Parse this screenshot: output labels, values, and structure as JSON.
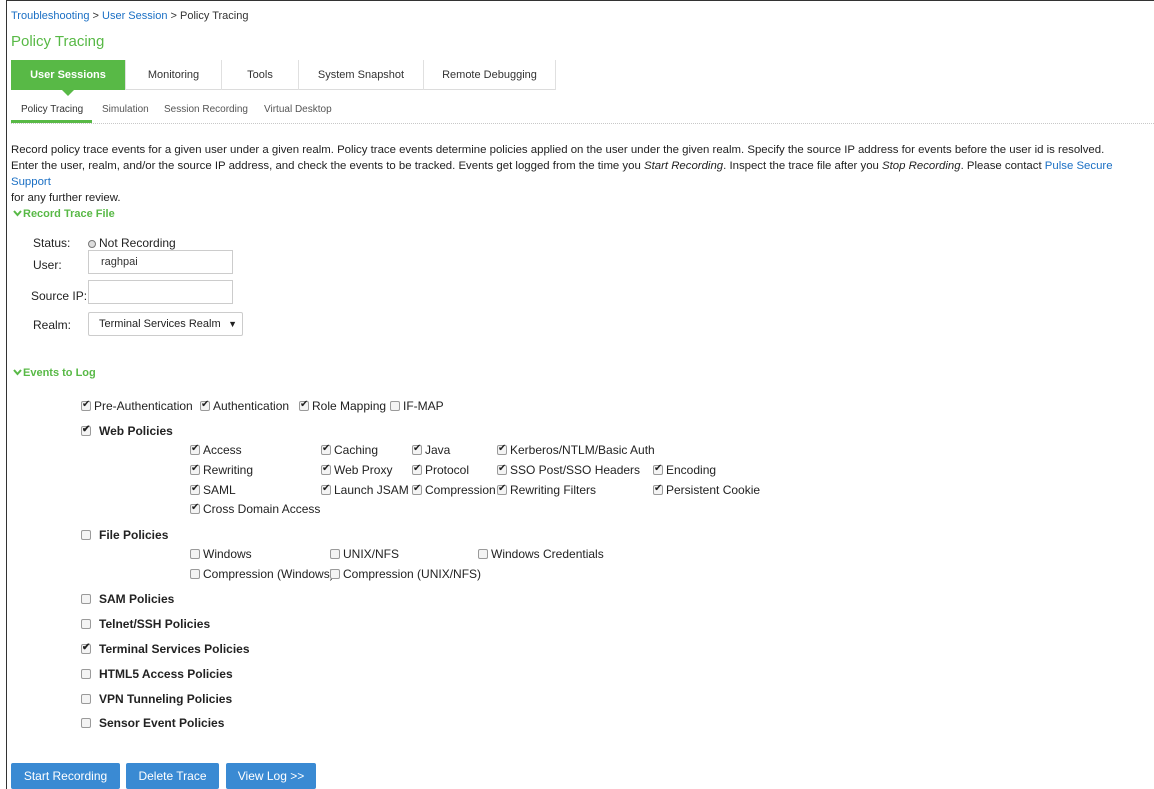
{
  "breadcrumb": {
    "part1": "Troubleshooting",
    "sep1": " > ",
    "part2": "User Session",
    "sep2": " > ",
    "current": "Policy Tracing"
  },
  "page_title": "Policy Tracing",
  "tabs": [
    {
      "label": "User Sessions",
      "active": true
    },
    {
      "label": "Monitoring"
    },
    {
      "label": "Tools"
    },
    {
      "label": "System Snapshot"
    },
    {
      "label": "Remote Debugging"
    }
  ],
  "subtabs": [
    "Policy Tracing",
    "Simulation",
    "Session Recording",
    "Virtual Desktop"
  ],
  "description": {
    "line1": "Record policy trace events for a given user under a given realm. Policy trace events determine policies applied on the user under the given realm. Specify the source IP address for events before the user id is resolved.",
    "line2a": "Enter the user, realm, and/or the source IP address, and check the events to be tracked. Events get logged from the time you ",
    "line2b": "Start Recording",
    "line2c": ". Inspect the trace file after you ",
    "line2d": "Stop Recording",
    "line2e": ". Please contact ",
    "link": "Pulse Secure Support",
    "line3": "for any further review."
  },
  "record_trace": {
    "header": "Record Trace File",
    "status_label": "Status:",
    "status_value": "Not Recording",
    "user_label": "User:",
    "user_value": "raghpai",
    "source_ip_label": "Source IP:",
    "source_ip_value": "",
    "realm_label": "Realm:",
    "realm_value": "Terminal Services Realm"
  },
  "events": {
    "header": "Events to Log",
    "top": [
      {
        "label": "Pre-Authentication",
        "checked": true
      },
      {
        "label": "Authentication",
        "checked": true
      },
      {
        "label": "Role Mapping",
        "checked": true
      },
      {
        "label": "IF-MAP",
        "checked": false
      }
    ],
    "web_policies": {
      "label": "Web Policies",
      "checked": true
    },
    "web": {
      "access": "Access",
      "caching": "Caching",
      "java": "Java",
      "kerberos": "Kerberos/NTLM/Basic Auth",
      "rewriting": "Rewriting",
      "web_proxy": "Web Proxy",
      "protocol": "Protocol",
      "sso": "SSO Post/SSO Headers",
      "encoding": "Encoding",
      "saml": "SAML",
      "launch_jsam": "Launch JSAM",
      "compression": "Compression",
      "rewriting_filters": "Rewriting Filters",
      "persistent_cookie": "Persistent Cookie",
      "cross_domain": "Cross Domain Access"
    },
    "file_policies": {
      "label": "File Policies",
      "checked": false
    },
    "file": {
      "windows": "Windows",
      "unix": "UNIX/NFS",
      "win_creds": "Windows Credentials",
      "comp_win": "Compression (Windows)",
      "comp_unix": "Compression (UNIX/NFS)"
    },
    "others": {
      "sam": "SAM Policies",
      "telnet": "Telnet/SSH Policies",
      "terminal": "Terminal Services Policies",
      "html5": "HTML5 Access Policies",
      "vpn": "VPN Tunneling Policies",
      "sensor": "Sensor Event Policies"
    }
  },
  "buttons": {
    "start": "Start Recording",
    "delete": "Delete Trace",
    "view": "View Log >>"
  }
}
